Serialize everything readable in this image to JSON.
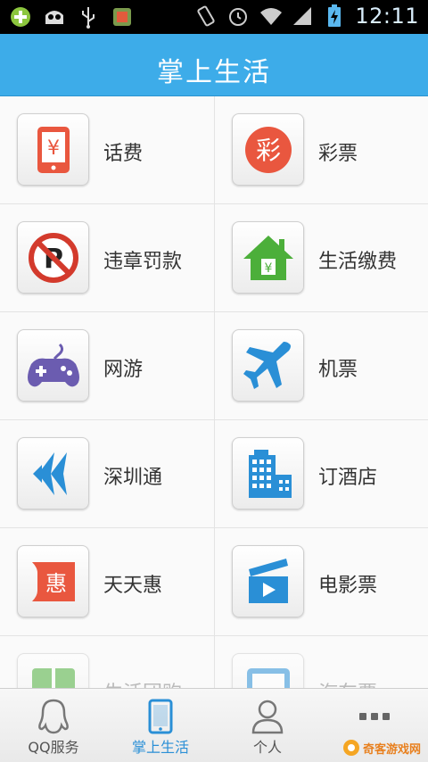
{
  "status_bar": {
    "time": "12:11"
  },
  "header": {
    "title": "掌上生活"
  },
  "grid": {
    "items": [
      {
        "label": "话费"
      },
      {
        "label": "彩票"
      },
      {
        "label": "违章罚款"
      },
      {
        "label": "生活缴费"
      },
      {
        "label": "网游"
      },
      {
        "label": "机票"
      },
      {
        "label": "深圳通"
      },
      {
        "label": "订酒店"
      },
      {
        "label": "天天惠"
      },
      {
        "label": "电影票"
      },
      {
        "label": "生活团购"
      },
      {
        "label": "汽车票"
      }
    ]
  },
  "tabbar": {
    "tabs": [
      {
        "label": "QQ服务"
      },
      {
        "label": "掌上生活"
      },
      {
        "label": "个人"
      },
      {
        "label": ""
      }
    ]
  },
  "watermark": {
    "text": "奇客游戏网"
  },
  "colors": {
    "header": "#3dace9",
    "active_tab": "#2a8fd6"
  }
}
